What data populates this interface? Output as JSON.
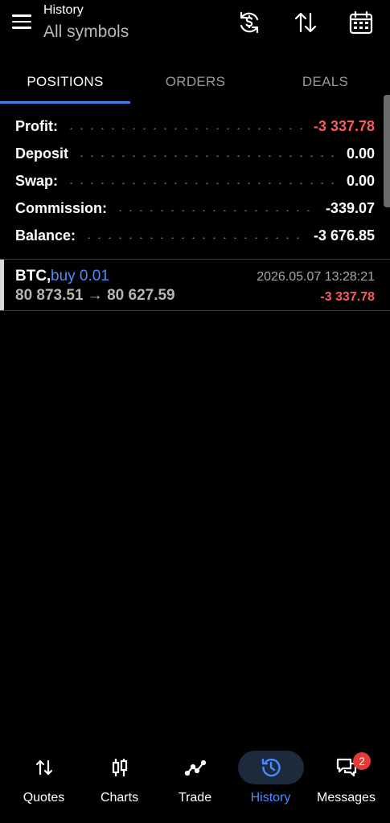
{
  "header": {
    "section": "History",
    "filter": "All symbols"
  },
  "icons": {
    "menu": "hamburger-menu-icon",
    "currency_sync": "dollar-sync-icon",
    "sort": "sort-arrows-icon",
    "calendar": "calendar-icon"
  },
  "tabs": [
    {
      "label": "POSITIONS",
      "active": true
    },
    {
      "label": "ORDERS",
      "active": false
    },
    {
      "label": "DEALS",
      "active": false
    }
  ],
  "summary": {
    "profit": {
      "label": "Profit:",
      "value": "-3 337.78"
    },
    "deposit": {
      "label": "Deposit",
      "value": "0.00"
    },
    "swap": {
      "label": "Swap:",
      "value": "0.00"
    },
    "commission": {
      "label": "Commission:",
      "value": "-339.07"
    },
    "balance": {
      "label": "Balance:",
      "value": "-3 676.85"
    }
  },
  "deals": [
    {
      "symbol": "BTC,",
      "side": "buy 0.01",
      "prices": "80 873.51 → 80 627.59",
      "time": "2026.05.07 13:28:21",
      "profit": "-3 337.78"
    }
  ],
  "nav": [
    {
      "label": "Quotes",
      "icon": "quotes-arrows-icon",
      "active": false
    },
    {
      "label": "Charts",
      "icon": "candlestick-icon",
      "active": false
    },
    {
      "label": "Trade",
      "icon": "trade-line-icon",
      "active": false
    },
    {
      "label": "History",
      "icon": "history-clock-icon",
      "active": true
    },
    {
      "label": "Messages",
      "icon": "messages-icon",
      "active": false,
      "badge": "2"
    }
  ],
  "colors": {
    "accent": "#4a8cff",
    "negative": "#ff5a5a",
    "background": "#000000"
  }
}
